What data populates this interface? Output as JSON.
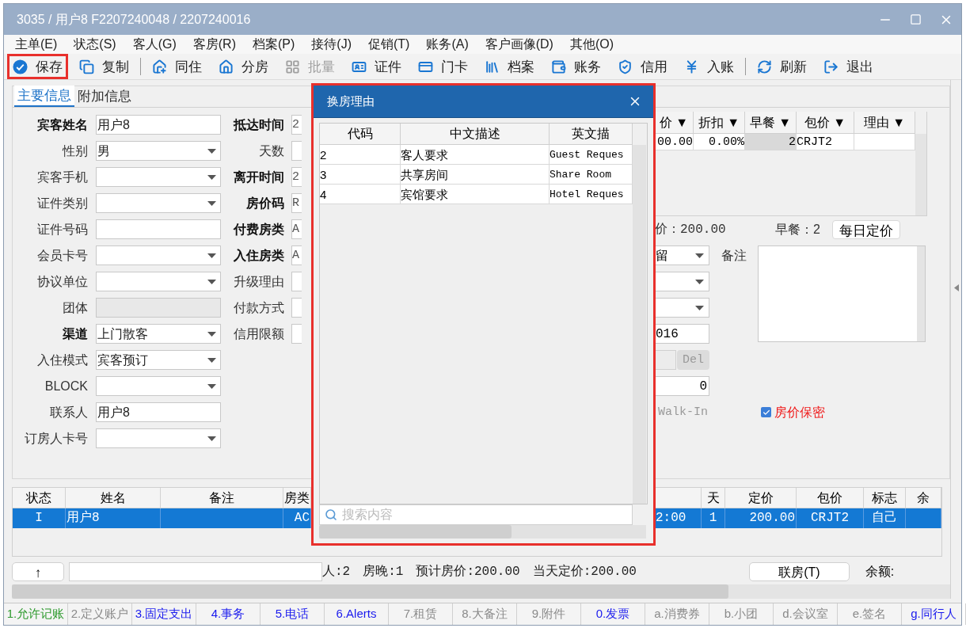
{
  "window": {
    "title": "3035 / 用户8 F2207240048 / 2207240016"
  },
  "menu": [
    "主单(E)",
    "状态(S)",
    "客人(G)",
    "客房(R)",
    "档案(P)",
    "接待(J)",
    "促销(T)",
    "账务(A)",
    "客户画像(D)",
    "其他(O)"
  ],
  "toolbar": [
    {
      "kind": "button",
      "label": "保存",
      "highlighted": true,
      "disabled": false
    },
    {
      "kind": "button",
      "label": "复制",
      "highlighted": false,
      "disabled": false
    },
    {
      "kind": "separator"
    },
    {
      "kind": "button",
      "label": "同住",
      "highlighted": false,
      "disabled": false
    },
    {
      "kind": "button",
      "label": "分房",
      "highlighted": false,
      "disabled": false
    },
    {
      "kind": "button",
      "label": "批量",
      "highlighted": false,
      "disabled": true
    },
    {
      "kind": "button",
      "label": "证件",
      "highlighted": false,
      "disabled": false
    },
    {
      "kind": "button",
      "label": "门卡",
      "highlighted": false,
      "disabled": false
    },
    {
      "kind": "button",
      "label": "档案",
      "highlighted": false,
      "disabled": false
    },
    {
      "kind": "button",
      "label": "账务",
      "highlighted": false,
      "disabled": false
    },
    {
      "kind": "button",
      "label": "信用",
      "highlighted": false,
      "disabled": false
    },
    {
      "kind": "button",
      "label": "入账",
      "highlighted": false,
      "disabled": false
    },
    {
      "kind": "separator"
    },
    {
      "kind": "button",
      "label": "刷新",
      "highlighted": false,
      "disabled": false
    },
    {
      "kind": "button",
      "label": "退出",
      "highlighted": false,
      "disabled": false
    }
  ],
  "tabs": [
    {
      "label": "主要信息",
      "selected": true
    },
    {
      "label": "附加信息",
      "selected": false
    }
  ],
  "form_left": [
    {
      "label": "宾客姓名",
      "bold": true,
      "kind": "text",
      "value": "用户8"
    },
    {
      "label": "性别",
      "bold": false,
      "kind": "select",
      "value": "男"
    },
    {
      "label": "宾客手机",
      "bold": false,
      "kind": "select"
    },
    {
      "label": "证件类别",
      "bold": false,
      "kind": "select"
    },
    {
      "label": "证件号码",
      "bold": false,
      "kind": "text"
    },
    {
      "label": "会员卡号",
      "bold": false,
      "kind": "select"
    },
    {
      "label": "协议单位",
      "bold": false,
      "kind": "select"
    },
    {
      "label": "团体",
      "bold": false,
      "kind": "readonly"
    },
    {
      "label": "渠道",
      "bold": true,
      "kind": "select",
      "value": "上门散客"
    },
    {
      "label": "入住模式",
      "bold": false,
      "kind": "select",
      "value": "宾客预订"
    },
    {
      "label": "BLOCK",
      "bold": false,
      "kind": "select"
    },
    {
      "label": "联系人",
      "bold": false,
      "kind": "text",
      "value": "用户8"
    },
    {
      "label": "订房人卡号",
      "bold": false,
      "kind": "select"
    }
  ],
  "form_middle": [
    {
      "label": "抵达时间",
      "bold": true,
      "value": "2"
    },
    {
      "label": "天数",
      "bold": false
    },
    {
      "label": "离开时间",
      "bold": true,
      "value": "2"
    },
    {
      "label": "房价码",
      "bold": true,
      "value": "R"
    },
    {
      "label": "付费房类",
      "bold": true,
      "value": "A"
    },
    {
      "label": "入住房类",
      "bold": true,
      "value": "A"
    },
    {
      "label": "升级理由",
      "bold": false
    },
    {
      "label": "付款方式",
      "bold": false
    },
    {
      "label": "信用限额",
      "bold": false
    }
  ],
  "rate_grid": {
    "columns": [
      "价 ▼",
      "折扣 ▼",
      "早餐 ▼",
      "包价 ▼",
      "理由 ▼"
    ],
    "row": [
      "00.00",
      "0.00%",
      "2",
      "CRJT2"
    ]
  },
  "rate_summary": {
    "price": "价：200.00",
    "breakfast": "早餐：2",
    "button": "每日定价"
  },
  "form_right": [
    {
      "kind": "select",
      "value": "留"
    },
    {
      "kind": "select"
    },
    {
      "kind": "select"
    },
    {
      "kind": "text",
      "value": "016"
    },
    {
      "kind": "del",
      "button": "Del"
    },
    {
      "kind": "number",
      "value": "0"
    },
    {
      "kind": "label",
      "value": "Walk-In"
    }
  ],
  "remarks": {
    "label": "备注"
  },
  "confidential": {
    "label": "房价保密",
    "checked": true
  },
  "dialog": {
    "title": "换房理由",
    "columns": [
      "代码",
      "中文描述",
      "英文描"
    ],
    "rows": [
      [
        "2",
        "客人要求",
        "Guest Reques"
      ],
      [
        "3",
        "共享房间",
        "Share Room"
      ],
      [
        "4",
        "宾馆要求",
        "Hotel Reques"
      ]
    ],
    "search_placeholder": "搜索内容"
  },
  "guest_grid": {
    "columns_left": [
      "状态",
      "姓名",
      "备注",
      "房类"
    ],
    "columns_right": [
      "天",
      "定价",
      "包价",
      "标志",
      "余"
    ],
    "rows": [
      {
        "selected": true,
        "status": "I",
        "name": "用户8",
        "room_type": "AC",
        "time": "2:00",
        "days": "1",
        "rate": "200.00",
        "package": "CRJT2",
        "flag": "自己"
      }
    ]
  },
  "totals": {
    "up_button": "↑",
    "stats": [
      "人:2",
      "房晚:1",
      "预计房价:200.00",
      "当天定价:200.00"
    ],
    "link_button": "联房(T)",
    "balance_label": "余额:"
  },
  "bottom_tabs": [
    {
      "label": "1.允许记账",
      "color": "#2e9a2e"
    },
    {
      "label": "2.定义账户",
      "color": "#8a8a8a"
    },
    {
      "label": "3.固定支出",
      "color": "#1a1aee"
    },
    {
      "label": "4.事务",
      "color": "#1a1aee"
    },
    {
      "label": "5.电话",
      "color": "#1a1aee"
    },
    {
      "label": "6.Alerts",
      "color": "#1a1aee"
    },
    {
      "label": "7.租赁",
      "color": "#8a8a8a"
    },
    {
      "label": "8.大备注",
      "color": "#8a8a8a"
    },
    {
      "label": "9.附件",
      "color": "#8a8a8a"
    },
    {
      "label": "0.发票",
      "color": "#1a1aee"
    },
    {
      "label": "a.消费券",
      "color": "#8a8a8a"
    },
    {
      "label": "b.小团",
      "color": "#8a8a8a"
    },
    {
      "label": "d.会议室",
      "color": "#8a8a8a"
    },
    {
      "label": "e.签名",
      "color": "#8a8a8a"
    },
    {
      "label": "g.同行人",
      "color": "#1a1aee"
    }
  ]
}
